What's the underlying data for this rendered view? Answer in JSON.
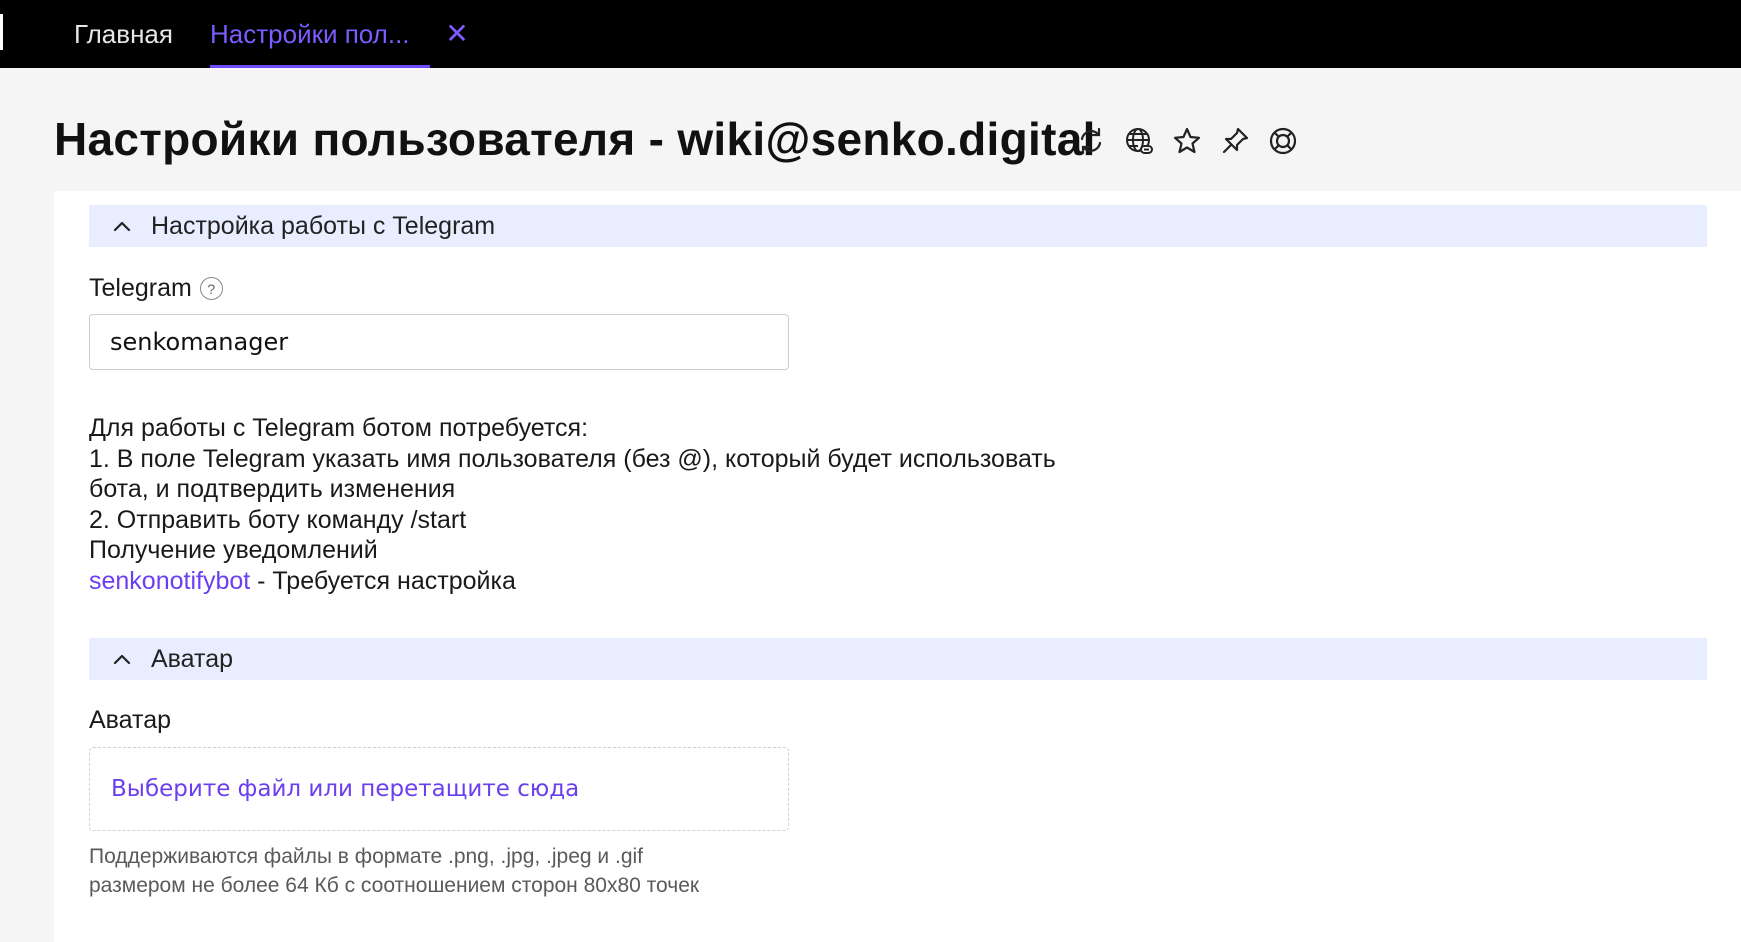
{
  "tabs": {
    "home_label": "Главная",
    "active_label": "Настройки пол...",
    "close_glyph": "✕"
  },
  "page": {
    "title": "Настройки пользователя - wiki@senko.digital",
    "icons": [
      "refresh-icon",
      "globe-link-icon",
      "star-icon",
      "pin-icon",
      "lifebuoy-icon"
    ]
  },
  "telegram_section": {
    "header": "Настройка работы с Telegram",
    "field_label": "Telegram",
    "help_glyph": "?",
    "input_value": "senkomanager",
    "info_lines": [
      "Для работы с Telegram ботом потребуется:",
      "1. В поле Telegram указать имя пользователя (без @), который будет использовать",
      "бота, и подтвердить изменения",
      "2. Отправить боту команду /start",
      "Получение уведомлений"
    ],
    "bot_link": "senkonotifybot",
    "bot_status": " - Требуется настройка"
  },
  "avatar_section": {
    "header": "Аватар",
    "field_label": "Аватар",
    "dropzone_text": "Выберите файл или перетащите сюда",
    "hint_lines": [
      "Поддерживаются файлы в формате .png, .jpg, .jpeg и .gif",
      "размером не более 64 Кб с соотношением сторон 80x80 точек"
    ]
  },
  "colors": {
    "accent": "#6a3ff0",
    "section_header_bg": "#e8edff",
    "topbar_bg": "#000000"
  }
}
